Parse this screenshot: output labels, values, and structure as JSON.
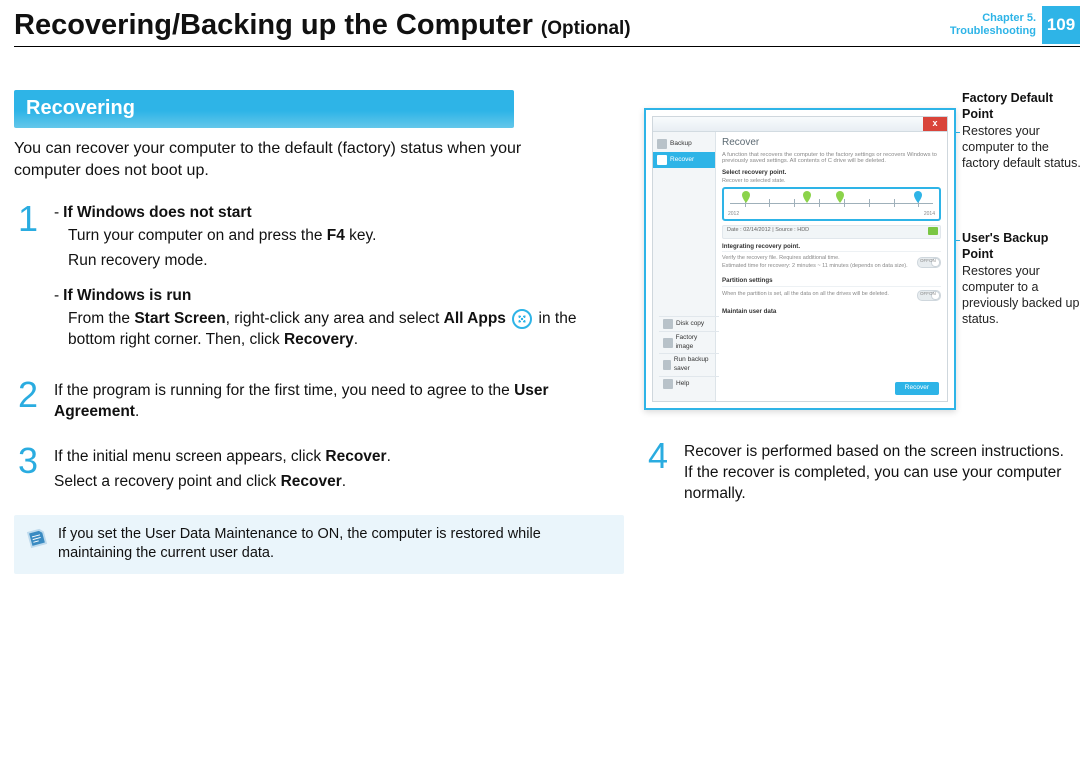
{
  "header": {
    "title_main": "Recovering/Backing up the Computer ",
    "title_sub": "(Optional)",
    "chapter_line1": "Chapter 5.",
    "chapter_line2": "Troubleshooting",
    "page_number": "109"
  },
  "section": {
    "heading": "Recovering",
    "intro": "You can recover your computer to the default (factory) status when your computer does not boot up."
  },
  "steps": {
    "s1": {
      "num": "1",
      "a_title": "If Windows does not start",
      "a_line1": "Turn your computer on and press the ",
      "a_key": "F4",
      "a_line1b": " key.",
      "a_line2": "Run recovery mode.",
      "b_title": "If Windows is run",
      "b_line_pre": "From the ",
      "b_bold1": "Start Screen",
      "b_line_mid": ", right-click any area and select ",
      "b_bold2": "All Apps",
      "b_line_post": " in the bottom right corner. Then, click ",
      "b_bold3": "Recovery",
      "b_line_end": "."
    },
    "s2": {
      "num": "2",
      "text_pre": "If the program is running for the first time, you need to agree to the ",
      "bold": "User Agreement",
      "text_post": "."
    },
    "s3": {
      "num": "3",
      "line1_pre": "If the initial menu screen appears, click ",
      "line1_bold": "Recover",
      "line1_post": ".",
      "line2_pre": "Select a recovery point and click ",
      "line2_bold": "Recover",
      "line2_post": "."
    },
    "note": "If you set the User Data Maintenance to ON, the computer is restored while maintaining the current user data.",
    "s4": {
      "num": "4",
      "text": "Recover is performed based on the screen instructions. If the recover is completed, you can use your computer normally."
    }
  },
  "screenshot": {
    "close": "x",
    "side_backup": "Backup",
    "side_recover": "Recover",
    "side_disk": "Disk copy",
    "side_factory": "Factory image",
    "side_run": "Run backup saver",
    "side_help": "Help",
    "main_title": "Recover",
    "main_desc": "A function that recovers the computer to the factory settings or recovers Windows to previously saved settings. All contents of C drive will be deleted.",
    "sub_select": "Select recovery point.",
    "sub_select2": "Recover to selected state.",
    "timeline_years": {
      "a": "2012",
      "b": "2014"
    },
    "datebar": "Date : 02/14/2012   |   Source : HDD",
    "sub_integrity": "Integrating recovery point.",
    "integrity_l1": "Verify the recovery file. Requires additional time.",
    "integrity_l2": "Estimated time for recovery: 2 minutes ~ 11 minutes (depends on data size).",
    "sub_partition": "Partition settings",
    "partition_text": "When the partition is set, all the data on all the drives will be deleted.",
    "sub_userdata": "Maintain user data",
    "toggle_off": "OFF",
    "toggle_on": "ON",
    "recover_btn": "Recover"
  },
  "callouts": {
    "factory_title": "Factory Default Point",
    "factory_text": "Restores your computer to the factory default status.",
    "user_title": "User's Backup Point",
    "user_text": "Restores your computer to a previously backed up status."
  }
}
